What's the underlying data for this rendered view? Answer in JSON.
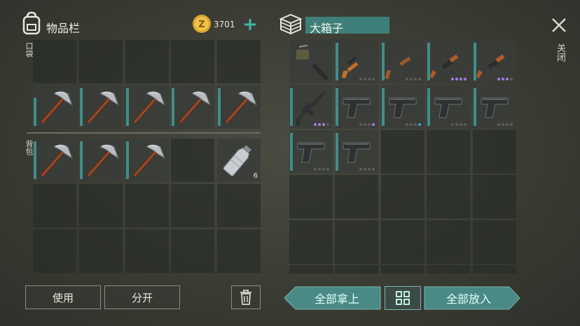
{
  "inventory": {
    "title": "物品栏",
    "coins": "3701",
    "pocket_label": "口袋",
    "backpack_label": "背包",
    "bottle_count": "6"
  },
  "chest": {
    "title": "大箱子",
    "close_label": "关闭"
  },
  "buttons": {
    "use": "使用",
    "split": "分开",
    "take_all": "全部拿上",
    "put_all": "全部放入"
  },
  "colors": {
    "accent": "#3f8e8a",
    "title_bar": "#3f7f7a",
    "rare_dot": "#a37be0",
    "blue_dot": "#3fa3d6"
  }
}
